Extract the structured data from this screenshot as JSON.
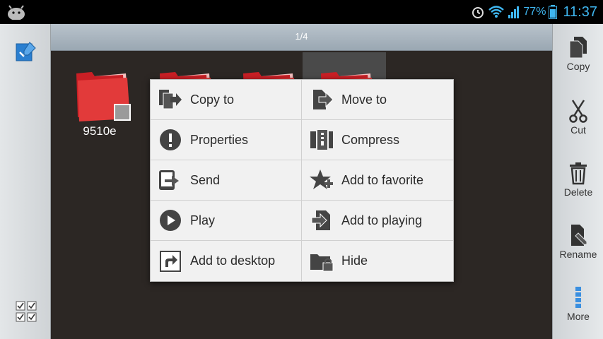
{
  "status_bar": {
    "battery_percent": "77%",
    "clock": "11:37",
    "icons": [
      "android-icon",
      "alarm-icon",
      "wifi-icon",
      "signal-icon",
      "battery-icon"
    ]
  },
  "main": {
    "page_indicator": "1/4",
    "files": [
      {
        "name": "9510e"
      },
      {
        "name": ""
      },
      {
        "name": ""
      },
      {
        "name": ""
      }
    ]
  },
  "context_menu": {
    "items": [
      {
        "label": "Copy to",
        "icon": "copy-to-icon"
      },
      {
        "label": "Move to",
        "icon": "move-to-icon"
      },
      {
        "label": "Properties",
        "icon": "info-icon"
      },
      {
        "label": "Compress",
        "icon": "compress-icon"
      },
      {
        "label": "Send",
        "icon": "send-icon"
      },
      {
        "label": "Add to favorite",
        "icon": "favorite-icon"
      },
      {
        "label": "Play",
        "icon": "play-icon"
      },
      {
        "label": "Add to playing",
        "icon": "add-to-playing-icon"
      },
      {
        "label": "Add to desktop",
        "icon": "add-to-desktop-icon"
      },
      {
        "label": "Hide",
        "icon": "hide-icon"
      }
    ]
  },
  "right_toolbar": {
    "copy_label": "Copy",
    "cut_label": "Cut",
    "delete_label": "Delete",
    "rename_label": "Rename",
    "more_label": "More"
  },
  "colors": {
    "accent_blue": "#3fb6f0",
    "folder_red": "#e23a3a",
    "main_bg": "#2c2724",
    "menu_bg": "#f1f1f1"
  }
}
